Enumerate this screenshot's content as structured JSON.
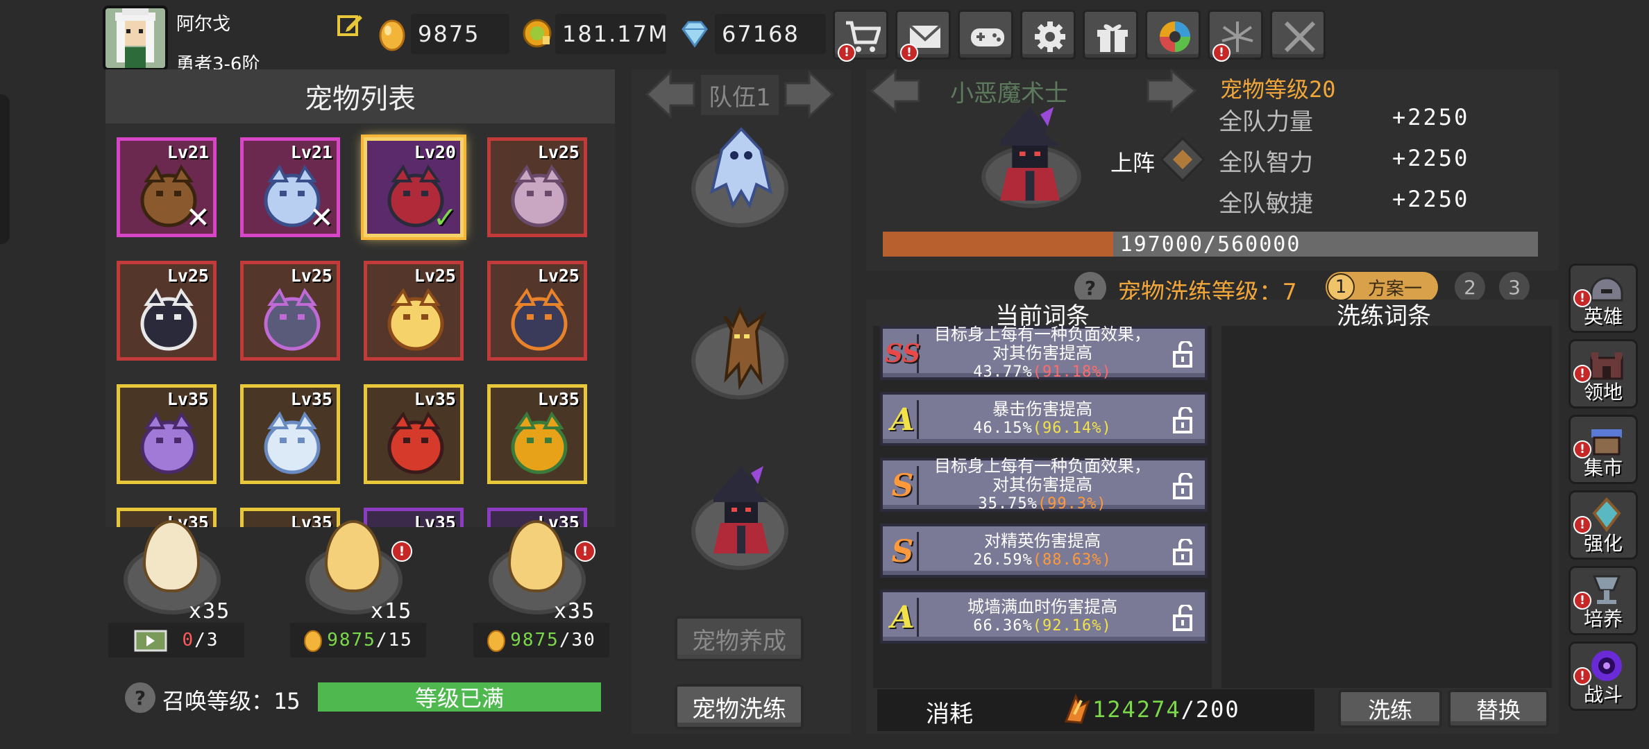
{
  "player": {
    "name": "阿尔戈",
    "rank": "勇者3-6阶"
  },
  "currencies": {
    "gold": "9875",
    "coins": "181.17M",
    "gems": "67168"
  },
  "toolbar": [
    "shop",
    "mail",
    "gamepad",
    "settings",
    "gift",
    "aperture",
    "fireworks",
    "battle"
  ],
  "pet_list": {
    "title": "宠物列表",
    "slots": [
      {
        "level": "Lv21",
        "frame": "pink",
        "mark": "✕",
        "pet": "treant-icon"
      },
      {
        "level": "Lv21",
        "frame": "pink",
        "mark": "✕",
        "pet": "ice-spirit-icon"
      },
      {
        "level": "Lv20",
        "frame": "purple-selected",
        "mark": "✓",
        "pet": "imp-magician-icon"
      },
      {
        "level": "Lv25",
        "frame": "red",
        "mark": "",
        "pet": "bat-icon"
      },
      {
        "level": "Lv25",
        "frame": "red",
        "mark": "",
        "pet": "reaper-icon"
      },
      {
        "level": "Lv25",
        "frame": "red",
        "mark": "",
        "pet": "pony-icon"
      },
      {
        "level": "Lv25",
        "frame": "red",
        "mark": "",
        "pet": "skull-mage-icon"
      },
      {
        "level": "Lv25",
        "frame": "red",
        "mark": "",
        "pet": "dark-bat-icon"
      },
      {
        "level": "Lv35",
        "frame": "gold",
        "mark": "",
        "pet": "scorpion-icon"
      },
      {
        "level": "Lv35",
        "frame": "gold",
        "mark": "",
        "pet": "ice-wolf-icon"
      },
      {
        "level": "Lv35",
        "frame": "gold",
        "mark": "",
        "pet": "fire-beast-icon"
      },
      {
        "level": "Lv35",
        "frame": "gold",
        "mark": "",
        "pet": "flower-turtle-icon"
      },
      {
        "level": "Lv35",
        "frame": "gold",
        "mark": "",
        "pet": "unknown"
      },
      {
        "level": "Lv35",
        "frame": "gold",
        "mark": "",
        "pet": "unknown"
      },
      {
        "level": "Lv35",
        "frame": "purple",
        "mark": "",
        "pet": "unknown"
      },
      {
        "level": "Lv35",
        "frame": "purple",
        "mark": "",
        "pet": "unknown"
      }
    ]
  },
  "eggs": [
    {
      "count": "x35",
      "cost_have": "0",
      "cost_need": "/3",
      "cost_type": "ad",
      "alert": false
    },
    {
      "count": "x15",
      "cost_have": "9875",
      "cost_need": "/15",
      "cost_type": "gold",
      "alert": true
    },
    {
      "count": "x35",
      "cost_have": "9875",
      "cost_need": "/30",
      "cost_type": "gold",
      "alert": true
    }
  ],
  "summon": {
    "label": "召唤等级：",
    "level": "15",
    "status": "等级已满",
    "progress": 1.0
  },
  "team": {
    "title": "队伍1",
    "members": [
      "ice-spirit-icon",
      "treant-icon",
      "imp-magician-icon"
    ],
    "btn_upgrade": "宠物养成",
    "btn_refine": "宠物洗练"
  },
  "detail": {
    "name": "小恶魔术士",
    "level_label": "宠物等级20",
    "deploy_label": "上阵",
    "stats": [
      {
        "label": "全队力量",
        "value": "+2250"
      },
      {
        "label": "全队智力",
        "value": "+2250"
      },
      {
        "label": "全队敏捷",
        "value": "+2250"
      }
    ],
    "exp_text": "197000/560000",
    "exp_progress": 0.352
  },
  "refine": {
    "level_label": "宠物洗练等级：",
    "level": "7",
    "plans": [
      {
        "num": "1",
        "label": "方案一"
      },
      {
        "num": "2"
      },
      {
        "num": "3"
      }
    ],
    "current_header": "当前词条",
    "new_header": "洗练词条",
    "entries": [
      {
        "grade": "SS",
        "line1": "目标身上每有一种负面效果，",
        "line2": "对其伤害提高",
        "pct": "43.77%",
        "max": "(91.18%)",
        "max_color": "#ff6b6b"
      },
      {
        "grade": "A",
        "line1": "暴击伤害提高",
        "line2": "",
        "pct": "46.15%",
        "max": "(96.14%)",
        "max_color": "#f2e24a"
      },
      {
        "grade": "S",
        "line1": "目标身上每有一种负面效果，",
        "line2": "对其伤害提高",
        "pct": "35.75%",
        "max": "(99.3%)",
        "max_color": "#ff9a3c"
      },
      {
        "grade": "S",
        "line1": "对精英伤害提高",
        "line2": "",
        "pct": "26.59%",
        "max": "(88.63%)",
        "max_color": "#ff9a3c"
      },
      {
        "grade": "A",
        "line1": "城墙满血时伤害提高",
        "line2": "",
        "pct": "66.36%",
        "max": "(92.16%)",
        "max_color": "#f2e24a"
      }
    ],
    "cost_label": "消耗",
    "cost_have": "124274",
    "cost_need": "/200",
    "btn_refine": "洗练",
    "btn_replace": "替换"
  },
  "side_nav": [
    {
      "label": "英雄",
      "icon": "helmet-icon"
    },
    {
      "label": "领地",
      "icon": "castle-icon"
    },
    {
      "label": "集市",
      "icon": "market-icon"
    },
    {
      "label": "强化",
      "icon": "crystal-icon"
    },
    {
      "label": "培养",
      "icon": "chalice-icon"
    },
    {
      "label": "战斗",
      "icon": "portal-icon"
    }
  ]
}
